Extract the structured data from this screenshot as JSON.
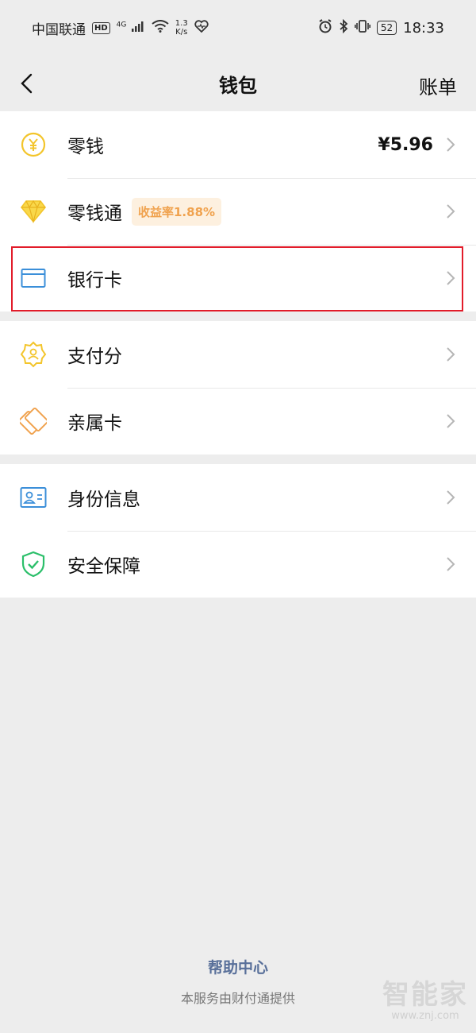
{
  "status": {
    "carrier": "中国联通",
    "hd": "HD",
    "network": "4G",
    "speed_value": "1.3",
    "speed_unit": "K/s",
    "battery": "52",
    "time": "18:33"
  },
  "nav": {
    "title": "钱包",
    "bill": "账单"
  },
  "groups": [
    [
      {
        "label": "零钱",
        "value": "¥5.96",
        "icon": "yuan-coin-icon"
      },
      {
        "label": "零钱通",
        "badge": "收益率1.88%",
        "icon": "diamond-icon"
      },
      {
        "label": "银行卡",
        "icon": "bank-card-icon",
        "highlighted": true
      }
    ],
    [
      {
        "label": "支付分",
        "icon": "pay-score-icon"
      },
      {
        "label": "亲属卡",
        "icon": "family-card-icon"
      }
    ],
    [
      {
        "label": "身份信息",
        "icon": "id-card-icon"
      },
      {
        "label": "安全保障",
        "icon": "shield-check-icon"
      }
    ]
  ],
  "footer": {
    "help": "帮助中心",
    "provider": "本服务由财付通提供"
  },
  "watermark": {
    "brand": "智能家",
    "url": "www.znj.com"
  },
  "colors": {
    "highlight_border": "#e21c2a",
    "coin_yellow": "#f3c52b",
    "card_blue": "#3b8fd9",
    "shield_green": "#2bbf6a",
    "family_orange": "#f0a24e",
    "link_blue": "#59709a"
  }
}
